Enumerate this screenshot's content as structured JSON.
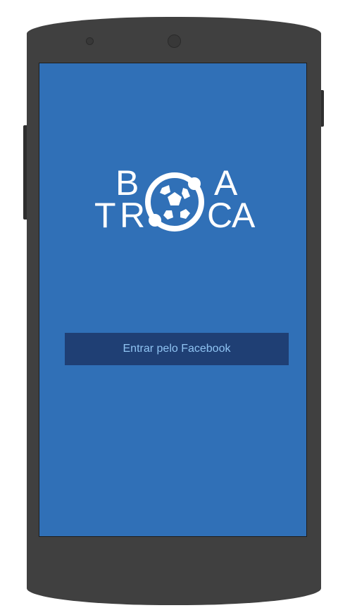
{
  "app": {
    "logo_line1_left": "B",
    "logo_line1_right": "A",
    "logo_line2_t": "T",
    "logo_line2_r": "R",
    "logo_line2_c": "C",
    "logo_line2_a": "A"
  },
  "login": {
    "facebook_button_label": "Entrar pelo Facebook"
  },
  "colors": {
    "screen_background": "#3070b7",
    "button_background": "#1f3f74",
    "button_text": "#8fc3f2",
    "device_body": "#404040"
  },
  "icons": {
    "logo_ball": "soccer-ball-icon"
  }
}
